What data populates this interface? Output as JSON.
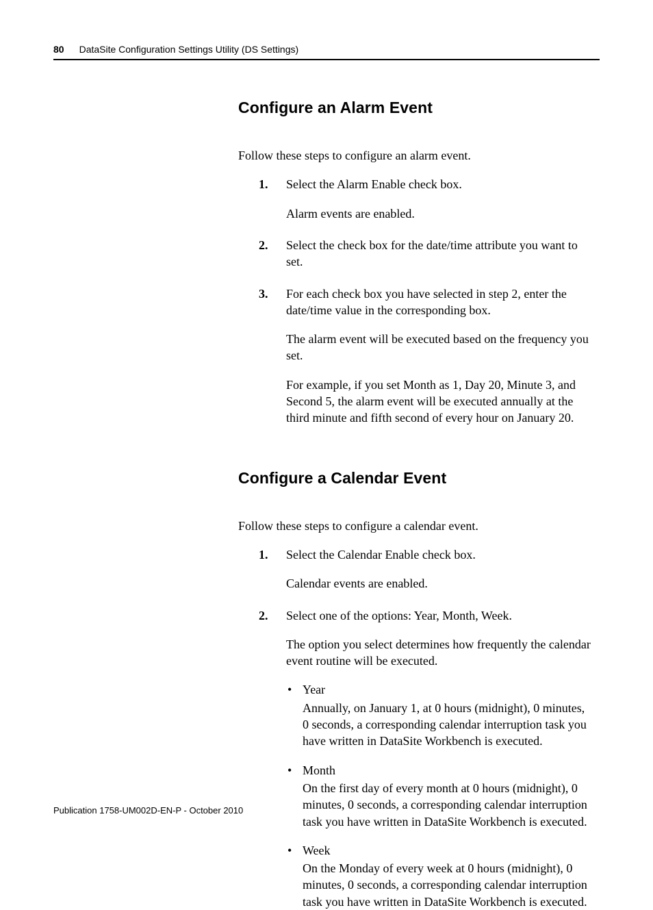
{
  "header": {
    "page_number": "80",
    "chapter_title": "DataSite Configuration Settings Utility (DS Settings)"
  },
  "section1": {
    "heading": "Configure an Alarm Event",
    "intro": "Follow these steps to configure an alarm event.",
    "steps": [
      {
        "num": "1.",
        "text": "Select the Alarm Enable check box.",
        "after": [
          "Alarm events are enabled."
        ]
      },
      {
        "num": "2.",
        "text": "Select the check box for the date/time attribute you want to set."
      },
      {
        "num": "3.",
        "text": "For each check box you have selected in step 2, enter the date/time value in the corresponding box.",
        "after": [
          "The alarm event will be executed based on the frequency you set.",
          "For example, if you set Month as 1, Day 20, Minute 3, and Second 5, the alarm event will be executed annually at the third minute and fifth second of every hour on January 20."
        ]
      }
    ]
  },
  "section2": {
    "heading": "Configure a Calendar Event",
    "intro": "Follow these steps to configure a calendar event.",
    "steps": [
      {
        "num": "1.",
        "text": "Select the Calendar Enable check box.",
        "after": [
          "Calendar events are enabled."
        ]
      },
      {
        "num": "2.",
        "text": "Select one of the options: Year, Month, Week.",
        "after": [
          "The option you select determines how frequently the calendar event routine will be executed."
        ],
        "bullets": [
          {
            "label": "Year",
            "desc": "Annually, on January 1, at 0 hours (midnight), 0 minutes, 0 seconds, a corresponding calendar interruption task you have written in DataSite Workbench is executed."
          },
          {
            "label": "Month",
            "desc": "On the first day of every month at 0 hours (midnight), 0 minutes, 0 seconds, a corresponding calendar interruption task you have written in DataSite Workbench is executed."
          },
          {
            "label": "Week",
            "desc": "On the Monday of every week at 0 hours (midnight), 0 minutes, 0 seconds, a corresponding calendar interruption task you have written in DataSite Workbench is executed."
          }
        ]
      }
    ]
  },
  "footer": "Publication 1758-UM002D-EN-P - October 2010"
}
